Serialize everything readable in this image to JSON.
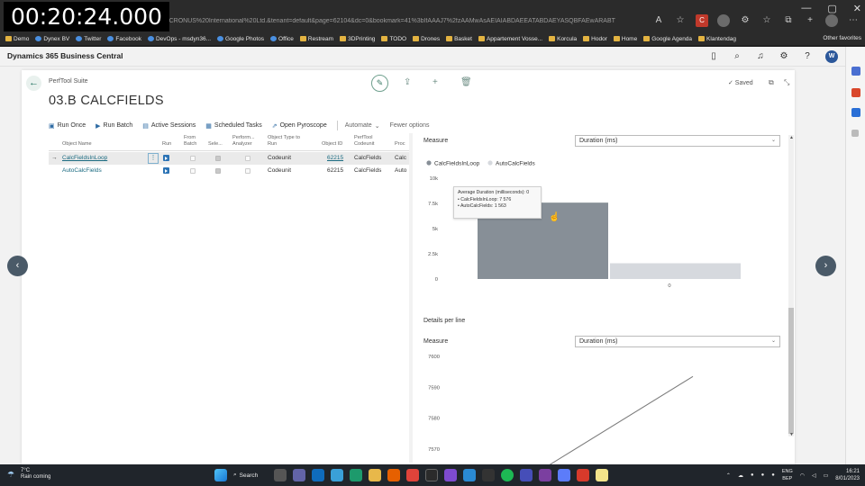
{
  "overlay": {
    "timestamp": "00:20:24.000"
  },
  "browser": {
    "url": "y=CRONUS%20International%20Ltd.&tenant=default&page=62104&dc=0&bookmark=41%3bIfAAAJ7%2fzAAMwAsAEIAIABDAEEATABDAEYASQBFAEwARABT",
    "bookmarks": [
      "Demo",
      "Dynex BV",
      "Twitter",
      "Facebook",
      "DevOps - msdyn36...",
      "Google Photos",
      "Office",
      "Restream",
      "3DPrinting",
      "TODO",
      "Drones",
      "Basket",
      "Appartement Vosse...",
      "Korcula",
      "Hodor",
      "Home",
      "Google Agenda",
      "Klantendag"
    ],
    "other_favorites": "Other favorites"
  },
  "bc": {
    "app_title": "Dynamics 365 Business Central",
    "avatar": "W",
    "breadcrumb": "PerfTool Suite",
    "page_title": "03.B CALCFIELDS",
    "saved": "✓ Saved"
  },
  "actions": [
    {
      "label": "Run Once",
      "icon": "▣"
    },
    {
      "label": "Run Batch",
      "icon": "▶"
    },
    {
      "label": "Active Sessions",
      "icon": "▤"
    },
    {
      "label": "Scheduled Tasks",
      "icon": "▦"
    },
    {
      "label": "Open Pyroscope",
      "icon": "⇗"
    }
  ],
  "actions_more": {
    "automate": "Automate",
    "fewer": "Fewer options"
  },
  "list": {
    "headers": {
      "object_name": "Object Name",
      "run": "Run",
      "from_batch": "From Batch",
      "select": "Sele...",
      "perform_analyzer": "Perform... Analyzer",
      "object_type": "Object Type to Run",
      "object_id": "Object ID",
      "perftool_codeunit": "PerfTool Codeunit",
      "proc": "Proc"
    },
    "rows": [
      {
        "object_name": "CalcFieldsInLoop",
        "object_type": "Codeunit",
        "object_id": "62215",
        "codeunit": "CalcFields",
        "proc": "Calc"
      },
      {
        "object_name": "AutoCalcFields",
        "object_type": "Codeunit",
        "object_id": "62215",
        "codeunit": "CalcFields",
        "proc": "Auto"
      }
    ]
  },
  "chart_panel": {
    "measure_label": "Measure",
    "measure_value": "Duration (ms)",
    "tooltip": {
      "title": "Average Duration (milliseconds): 0",
      "line1": "• CalcFieldsInLoop: 7 576",
      "line2": "• AutoCalcFields:    1 563"
    },
    "details_title": "Details per line",
    "measure2_label": "Measure",
    "measure2_value": "Duration (ms)"
  },
  "chart_data": [
    {
      "type": "bar",
      "categories": [
        "0"
      ],
      "series": [
        {
          "name": "CalcFieldsInLoop",
          "values": [
            7576
          ],
          "color": "#878f97"
        },
        {
          "name": "AutoCalcFields",
          "values": [
            1563
          ],
          "color": "#d6d9de"
        }
      ],
      "y_ticks": [
        "10k",
        "7.5k",
        "5k",
        "2.5k",
        "0"
      ],
      "ylim": [
        0,
        10000
      ],
      "legend": "top-left"
    },
    {
      "type": "line",
      "y_ticks": [
        "7600",
        "7590",
        "7580",
        "7570"
      ],
      "ylim": [
        7565,
        7600
      ],
      "series": [
        {
          "values": [
            7562,
            7593.5
          ],
          "color": "#7b7b7b"
        }
      ]
    }
  ],
  "taskbar": {
    "temp": "7°C",
    "weather": "Rain coming",
    "search": "Search",
    "lang1": "ENG",
    "lang2": "BEP",
    "time": "16:21",
    "date": "8/01/2023"
  }
}
